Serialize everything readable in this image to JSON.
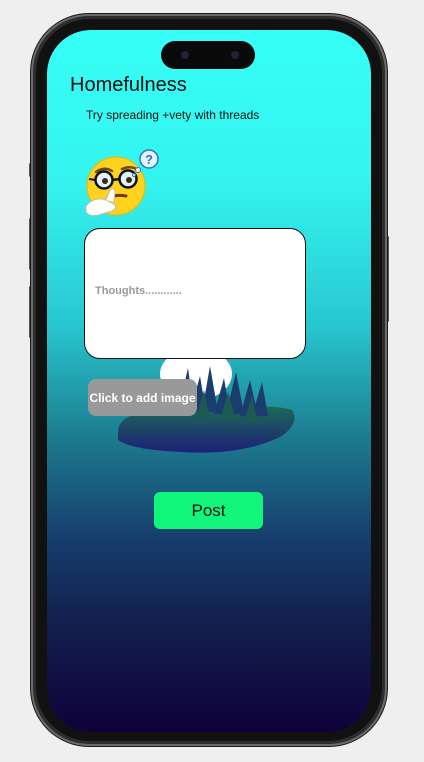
{
  "app": {
    "title": "Homefulness",
    "subtitle": "Try spreading +vety with threads"
  },
  "composer": {
    "placeholder": "Thoughts............",
    "value": ""
  },
  "actions": {
    "add_image_label": "Click to add image",
    "post_label": "Post"
  },
  "icons": {
    "thinking": "thinking-face-icon"
  },
  "colors": {
    "gradient_top": "#36fff6",
    "gradient_bottom": "#10013a",
    "post_button": "#12f57c",
    "add_image_button": "#999999"
  }
}
